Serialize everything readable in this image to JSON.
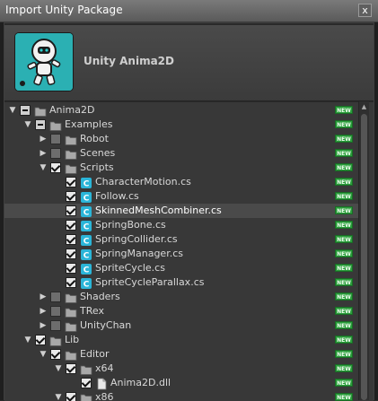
{
  "window": {
    "title": "Import Unity Package",
    "close_glyph": "x"
  },
  "package": {
    "name": "Unity Anima2D",
    "logo_icon": "unity-anima2d-robot-logo"
  },
  "badge_text": "NEW",
  "colors": {
    "badge": "#2b9e3c",
    "logo_bg": "#2bb0b3",
    "script_icon": "#2bb5d8"
  },
  "rows": [
    {
      "label": "Anima2D",
      "depth": 0,
      "expanded": true,
      "check": "mixed",
      "icon": "folder-icon",
      "sel": false
    },
    {
      "label": "Examples",
      "depth": 1,
      "expanded": true,
      "check": "mixed",
      "icon": "folder-icon",
      "sel": false
    },
    {
      "label": "Robot",
      "depth": 2,
      "expanded": false,
      "check": "off",
      "icon": "folder-icon",
      "sel": false
    },
    {
      "label": "Scenes",
      "depth": 2,
      "expanded": false,
      "check": "off",
      "icon": "folder-icon",
      "sel": false
    },
    {
      "label": "Scripts",
      "depth": 2,
      "expanded": true,
      "check": "on",
      "icon": "folder-icon",
      "sel": false
    },
    {
      "label": "CharacterMotion.cs",
      "depth": 3,
      "expanded": null,
      "check": "on",
      "icon": "cs-script-icon",
      "sel": false
    },
    {
      "label": "Follow.cs",
      "depth": 3,
      "expanded": null,
      "check": "on",
      "icon": "cs-script-icon",
      "sel": false
    },
    {
      "label": "SkinnedMeshCombiner.cs",
      "depth": 3,
      "expanded": null,
      "check": "on",
      "icon": "cs-script-icon",
      "sel": true
    },
    {
      "label": "SpringBone.cs",
      "depth": 3,
      "expanded": null,
      "check": "on",
      "icon": "cs-script-icon",
      "sel": false
    },
    {
      "label": "SpringCollider.cs",
      "depth": 3,
      "expanded": null,
      "check": "on",
      "icon": "cs-script-icon",
      "sel": false
    },
    {
      "label": "SpringManager.cs",
      "depth": 3,
      "expanded": null,
      "check": "on",
      "icon": "cs-script-icon",
      "sel": false
    },
    {
      "label": "SpriteCycle.cs",
      "depth": 3,
      "expanded": null,
      "check": "on",
      "icon": "cs-script-icon",
      "sel": false
    },
    {
      "label": "SpriteCycleParallax.cs",
      "depth": 3,
      "expanded": null,
      "check": "on",
      "icon": "cs-script-icon",
      "sel": false
    },
    {
      "label": "Shaders",
      "depth": 2,
      "expanded": false,
      "check": "off",
      "icon": "folder-icon",
      "sel": false
    },
    {
      "label": "TRex",
      "depth": 2,
      "expanded": false,
      "check": "off",
      "icon": "folder-icon",
      "sel": false
    },
    {
      "label": "UnityChan",
      "depth": 2,
      "expanded": false,
      "check": "off",
      "icon": "folder-icon",
      "sel": false
    },
    {
      "label": "Lib",
      "depth": 1,
      "expanded": true,
      "check": "on",
      "icon": "folder-icon",
      "sel": false
    },
    {
      "label": "Editor",
      "depth": 2,
      "expanded": true,
      "check": "on",
      "icon": "folder-icon",
      "sel": false
    },
    {
      "label": "x64",
      "depth": 3,
      "expanded": true,
      "check": "on",
      "icon": "folder-icon",
      "sel": false
    },
    {
      "label": "Anima2D.dll",
      "depth": 4,
      "expanded": null,
      "check": "on",
      "icon": "file-icon",
      "sel": false
    },
    {
      "label": "x86",
      "depth": 3,
      "expanded": true,
      "check": "on",
      "icon": "folder-icon",
      "sel": false
    }
  ]
}
